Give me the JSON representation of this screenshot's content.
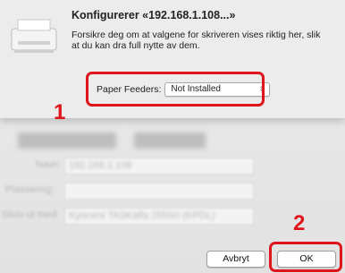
{
  "dialog": {
    "title": "Konfigurerer «192.168.1.108...»",
    "description": "Forsikre deg om at valgene for skriveren vises riktig her, slik at du kan dra full nytte av dem.",
    "option": {
      "label": "Paper Feeders:",
      "value": "Not Installed"
    }
  },
  "background": {
    "name_label": "Navn:",
    "name_value": "192.168.1.108",
    "location_label": "Plassering:",
    "print_using_label": "Skriv ut med:",
    "print_using_value": "Kyocera TASKalfa 2550ci (KPDL)"
  },
  "buttons": {
    "cancel": "Avbryt",
    "ok": "OK"
  },
  "markers": {
    "step1": "1",
    "step2": "2"
  },
  "colors": {
    "highlight": "#e0141d"
  }
}
